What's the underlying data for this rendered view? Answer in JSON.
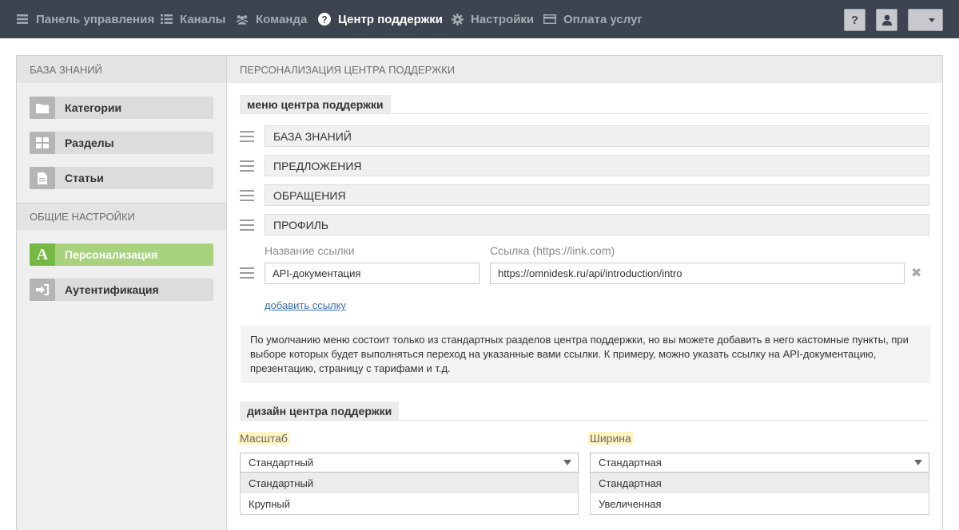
{
  "nav": {
    "items": [
      {
        "label": "Панель управления",
        "icon": "dashboard-icon"
      },
      {
        "label": "Каналы",
        "icon": "list-icon"
      },
      {
        "label": "Команда",
        "icon": "team-icon"
      },
      {
        "label": "Центр поддержки",
        "icon": "help-circle-icon"
      },
      {
        "label": "Настройки",
        "icon": "gear-icon"
      },
      {
        "label": "Оплата услуг",
        "icon": "credit-card-icon"
      }
    ],
    "help_btn": "?"
  },
  "sidebar": {
    "kb_title": "БАЗА ЗНАНИЙ",
    "kb_items": [
      {
        "label": "Категории",
        "icon": "folder-icon"
      },
      {
        "label": "Разделы",
        "icon": "grid-icon"
      },
      {
        "label": "Статьи",
        "icon": "document-icon"
      }
    ],
    "general_title": "ОБЩИЕ НАСТРОЙКИ",
    "general_items": [
      {
        "label": "Персонализация",
        "icon": "letter-a-icon"
      },
      {
        "label": "Аутентификация",
        "icon": "sign-in-icon"
      }
    ]
  },
  "main": {
    "header": "ПЕРСОНАЛИЗАЦИЯ ЦЕНТРА ПОДДЕРЖКИ",
    "menu_section_title": "меню центра поддержки",
    "menu_items": [
      "БАЗА ЗНАНИЙ",
      "ПРЕДЛОЖЕНИЯ",
      "ОБРАЩЕНИЯ",
      "ПРОФИЛЬ"
    ],
    "custom_link": {
      "name_label": "Название ссылки",
      "url_label": "Ссылка (https://link.com)",
      "name_value": "API-документация",
      "url_value": "https://omnidesk.ru/api/introduction/intro"
    },
    "add_link": "добавить ссылку",
    "info_text": "По умолчанию меню состоит только из стандартных разделов центра поддержки, но вы можете добавить в него кастомные пункты, при выборе которых будет выполняться переход на указанные вами ссылки. К примеру, можно указать ссылку на API-документацию, презентацию, страницу с тарифами и т.д.",
    "design_section_title": "дизайн центра поддержки",
    "scale": {
      "label": "Масштаб",
      "value": "Стандартный",
      "options": [
        "Стандартный",
        "Крупный"
      ]
    },
    "width": {
      "label": "Ширина",
      "value": "Стандартная",
      "options": [
        "Стандартная",
        "Увеличенная"
      ]
    }
  }
}
